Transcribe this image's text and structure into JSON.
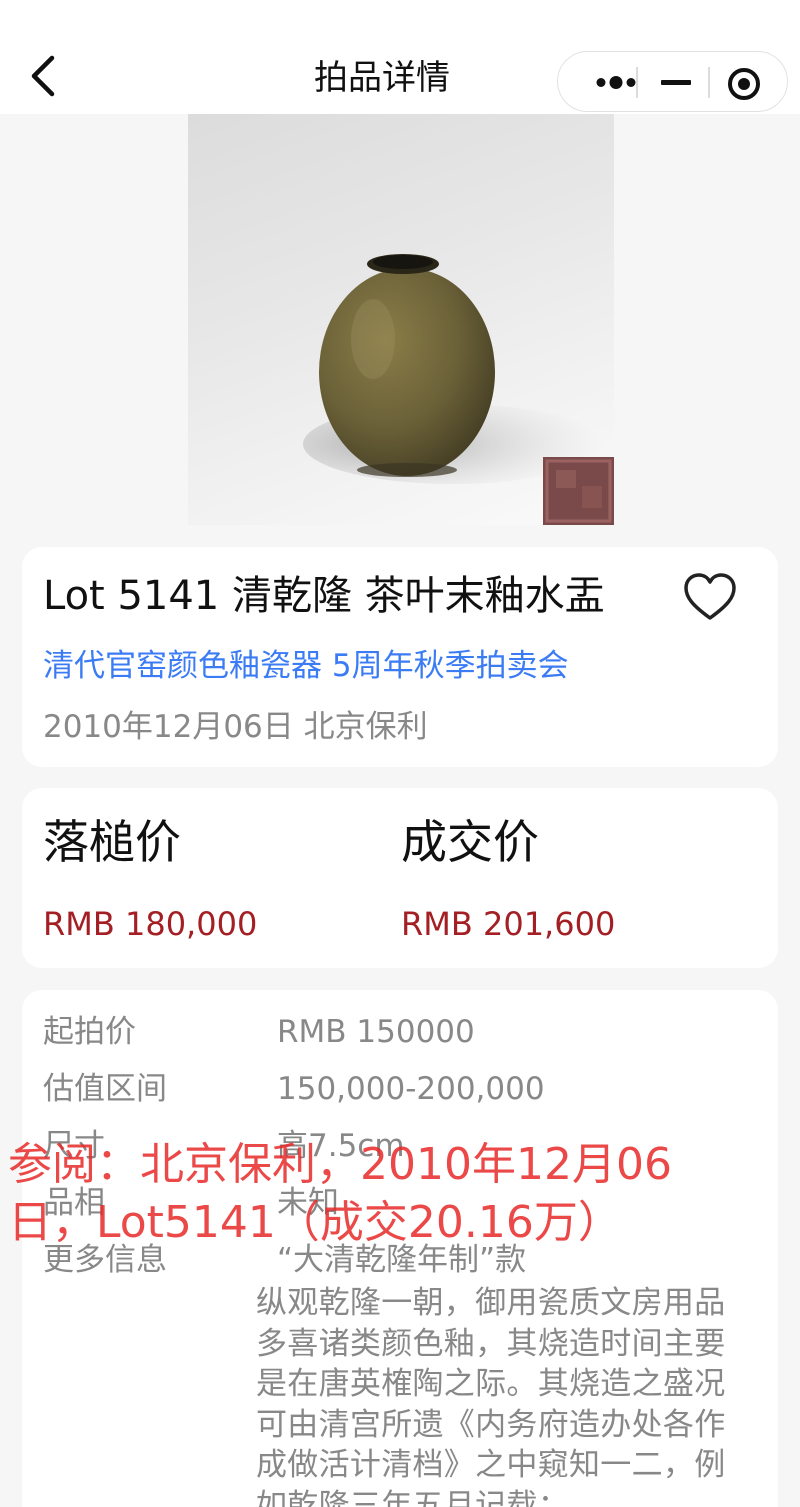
{
  "nav": {
    "title": "拍品详情",
    "back_icon": "chevron-left-icon",
    "capsule_icons": [
      "more-dots-icon",
      "minimize-icon",
      "target-close-icon"
    ]
  },
  "image": {
    "alt": "茶叶末釉水盂",
    "seal_color": "#7a4a4a"
  },
  "lot": {
    "title": "Lot 5141 清乾隆 茶叶末釉水盂",
    "sale_name": "清代官窑颜色釉瓷器 5周年秋季拍卖会",
    "meta": "2010年12月06日 北京保利",
    "favorite_icon": "heart-outline-icon"
  },
  "prices": {
    "hammer_label": "落槌价",
    "hammer_value": "RMB 180,000",
    "final_label": "成交价",
    "final_value": "RMB 201,600"
  },
  "details": {
    "rows": [
      {
        "label": "起拍价",
        "value": "RMB 150000"
      },
      {
        "label": "估值区间",
        "value": "150,000-200,000"
      },
      {
        "label": "尺寸",
        "value": "高7.5cm"
      },
      {
        "label": "品相",
        "value": "未知"
      },
      {
        "label": "更多信息",
        "value": "“大清乾隆年制”款"
      }
    ],
    "description": "纵观乾隆一朝，御用瓷质文房用品\n多喜诸类颜色釉，其烧造时间主要\n是在唐英榷陶之际。其烧造之盛况\n可由清宫所遗《内务府造办处各作\n成做活计清档》之中窥知一二，例\n如乾隆三年五月记载："
  },
  "watermark": "参阅：北京保利，2010年12月06\n日，Lot5141（成交20.16万）",
  "colors": {
    "accent_blue": "#3b7cf5",
    "price_red": "#a31f24",
    "watermark_red": "#e82828",
    "glaze_olive": "#6b6138"
  }
}
